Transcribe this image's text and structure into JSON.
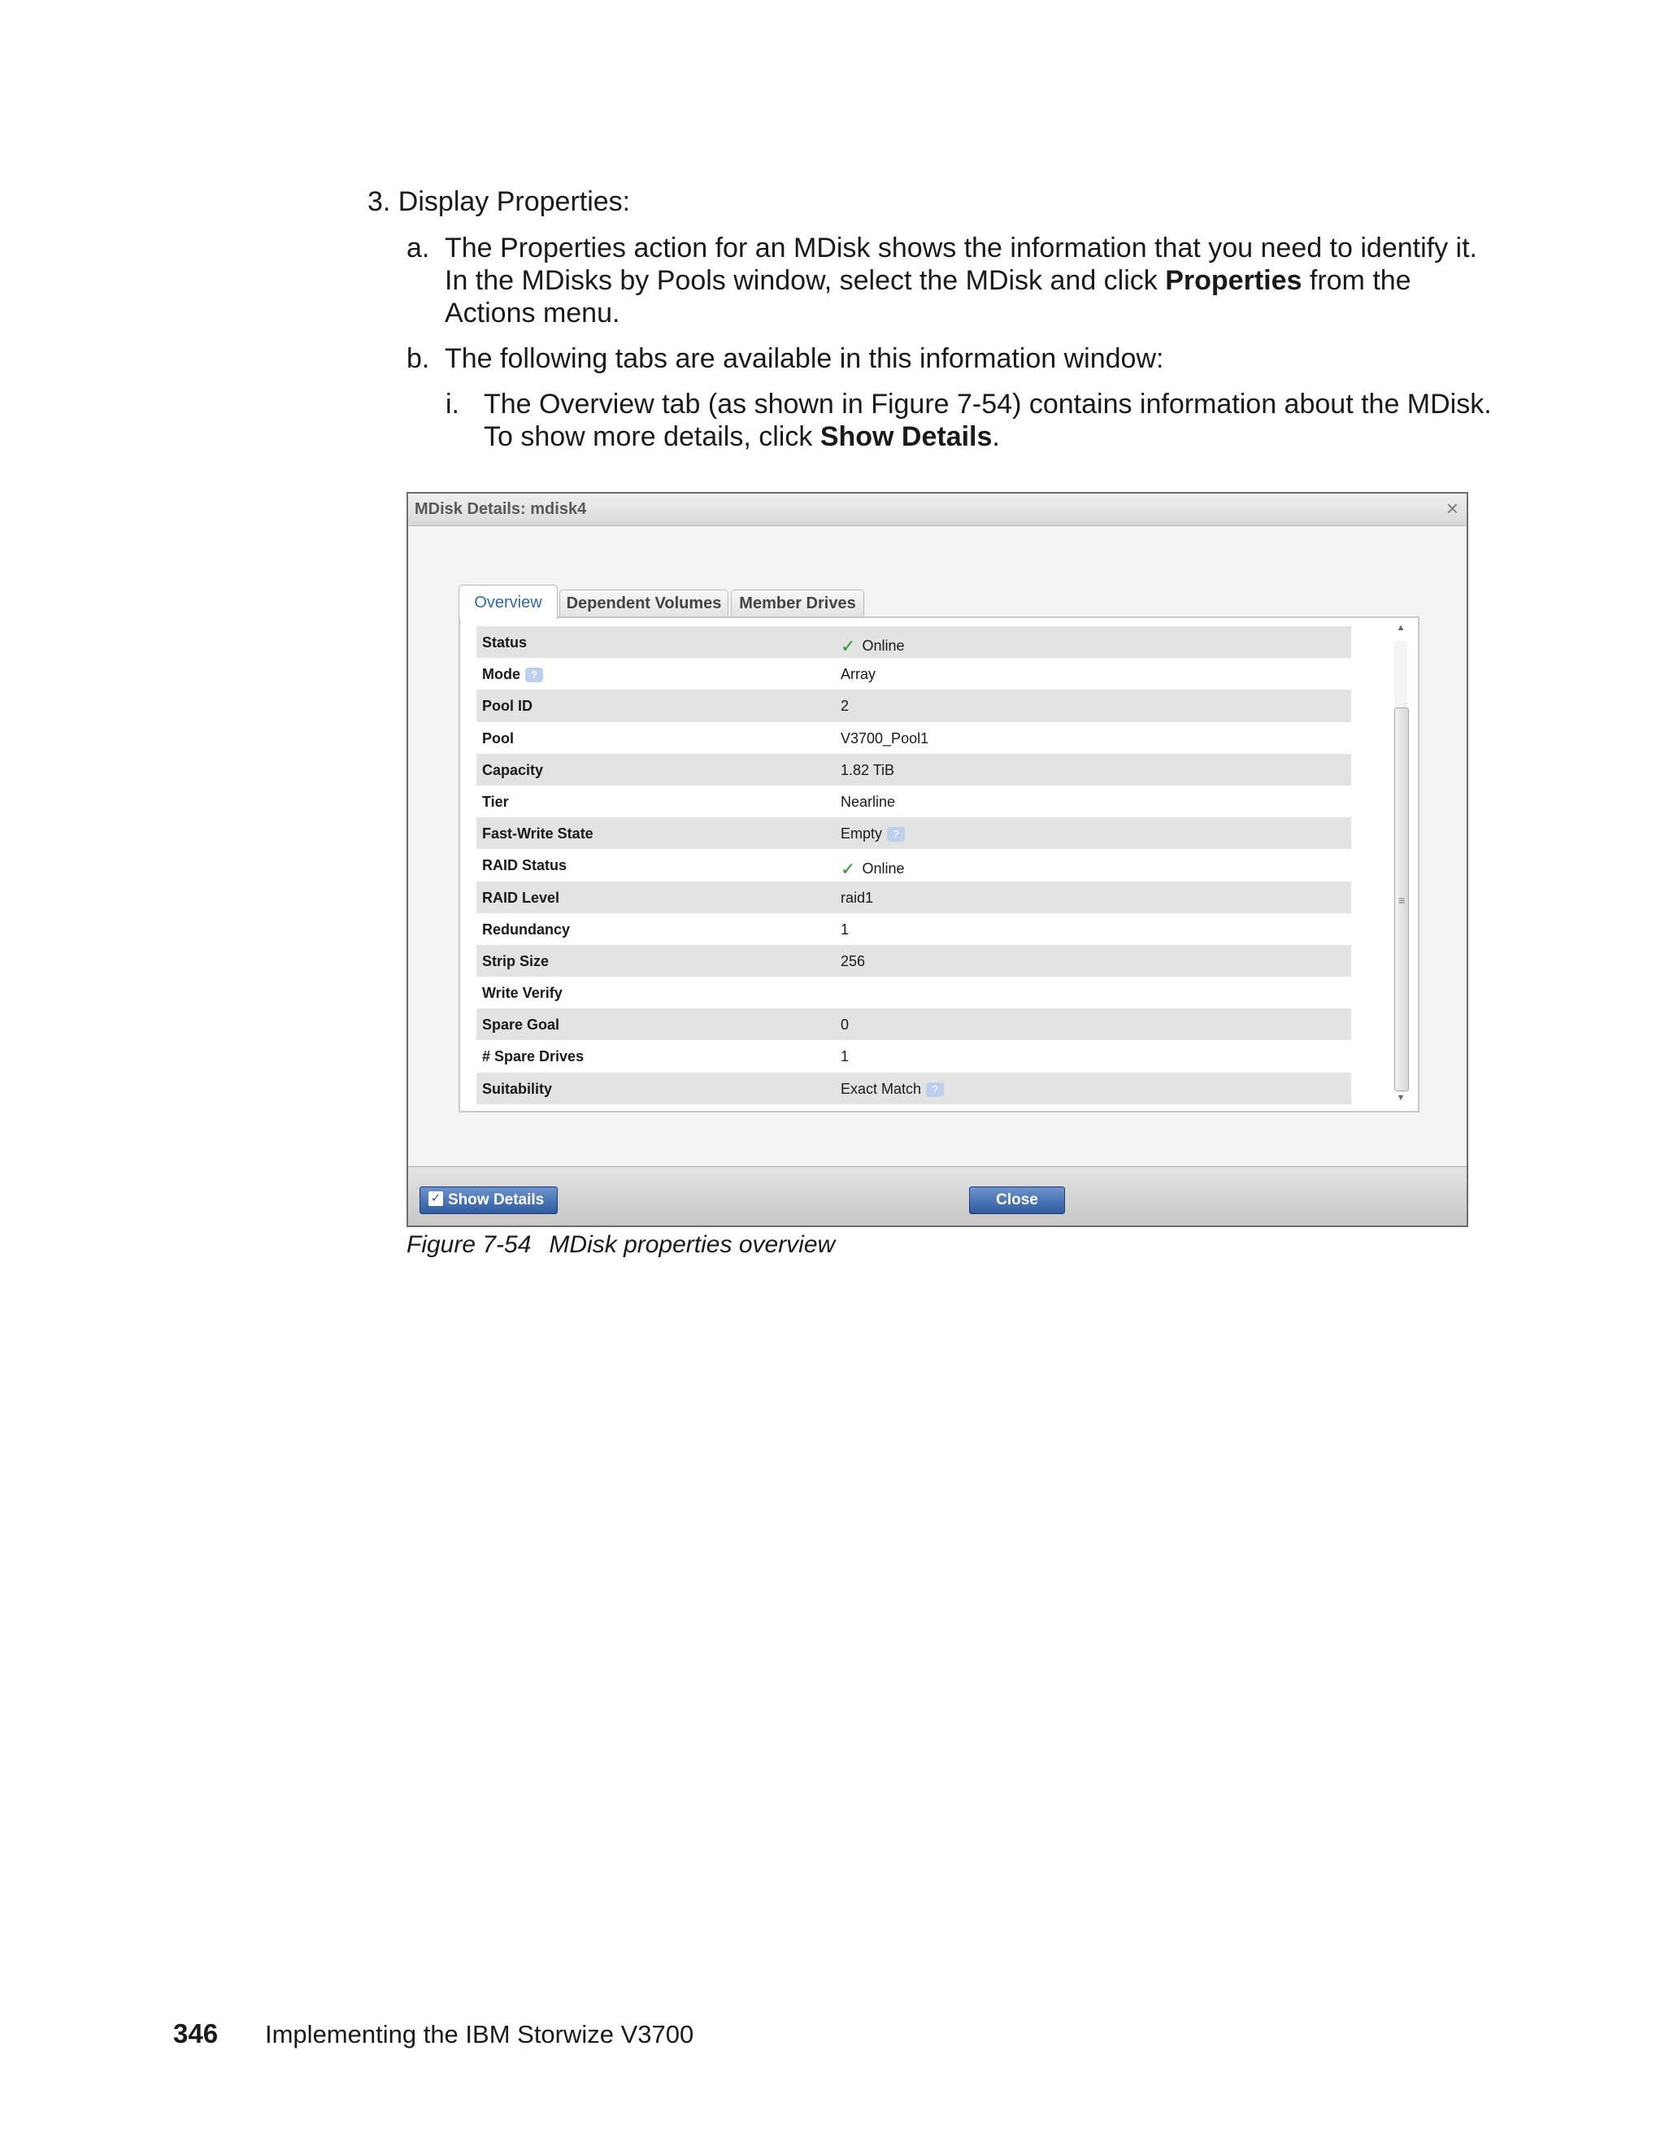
{
  "content": {
    "step3": "3.  Display Properties:",
    "a_marker": "a.",
    "a_line1": "The Properties action for an MDisk shows the information that you need to identify it.",
    "a_line2_pre": "In the MDisks by Pools window, select the MDisk and click ",
    "a_line2_bold": "Properties",
    "a_line2_post": " from the",
    "a_line3": "Actions menu.",
    "b_marker": "b.",
    "b_line1": "The following tabs are available in this information window:",
    "i_marker": "i.",
    "i_line1": "The Overview tab (as shown in Figure 7-54) contains information about the MDisk.",
    "i_line2_pre": "To show more details, click ",
    "i_line2_bold": "Show Details",
    "i_line2_post": "."
  },
  "dialog": {
    "title": "MDisk Details: mdisk4",
    "close_glyph": "×",
    "tabs": [
      "Overview",
      "Dependent Volumes",
      "Member Drives"
    ],
    "help_glyph": "?",
    "check_glyph": "✓",
    "properties": [
      {
        "label": "Status",
        "value": "Online"
      },
      {
        "label": "Mode",
        "value": "Array"
      },
      {
        "label": "Pool ID",
        "value": "2"
      },
      {
        "label": "Pool",
        "value": "V3700_Pool1"
      },
      {
        "label": "Capacity",
        "value": "1.82 TiB"
      },
      {
        "label": "Tier",
        "value": "Nearline"
      },
      {
        "label": "Fast-Write State",
        "value": "Empty"
      },
      {
        "label": "RAID Status",
        "value": "Online"
      },
      {
        "label": "RAID Level",
        "value": "raid1"
      },
      {
        "label": "Redundancy",
        "value": "1"
      },
      {
        "label": "Strip Size",
        "value": "256"
      },
      {
        "label": "Write Verify",
        "value": ""
      },
      {
        "label": "Spare Goal",
        "value": "0"
      },
      {
        "label": "# Spare Drives",
        "value": "1"
      },
      {
        "label": "Suitability",
        "value": "Exact Match"
      }
    ],
    "show_details_label": "Show Details",
    "close_label": "Close"
  },
  "caption": {
    "figure": "Figure 7-54",
    "text": "MDisk properties overview"
  },
  "footer": {
    "page_number": "346",
    "book_title": "Implementing the IBM Storwize V3700"
  }
}
